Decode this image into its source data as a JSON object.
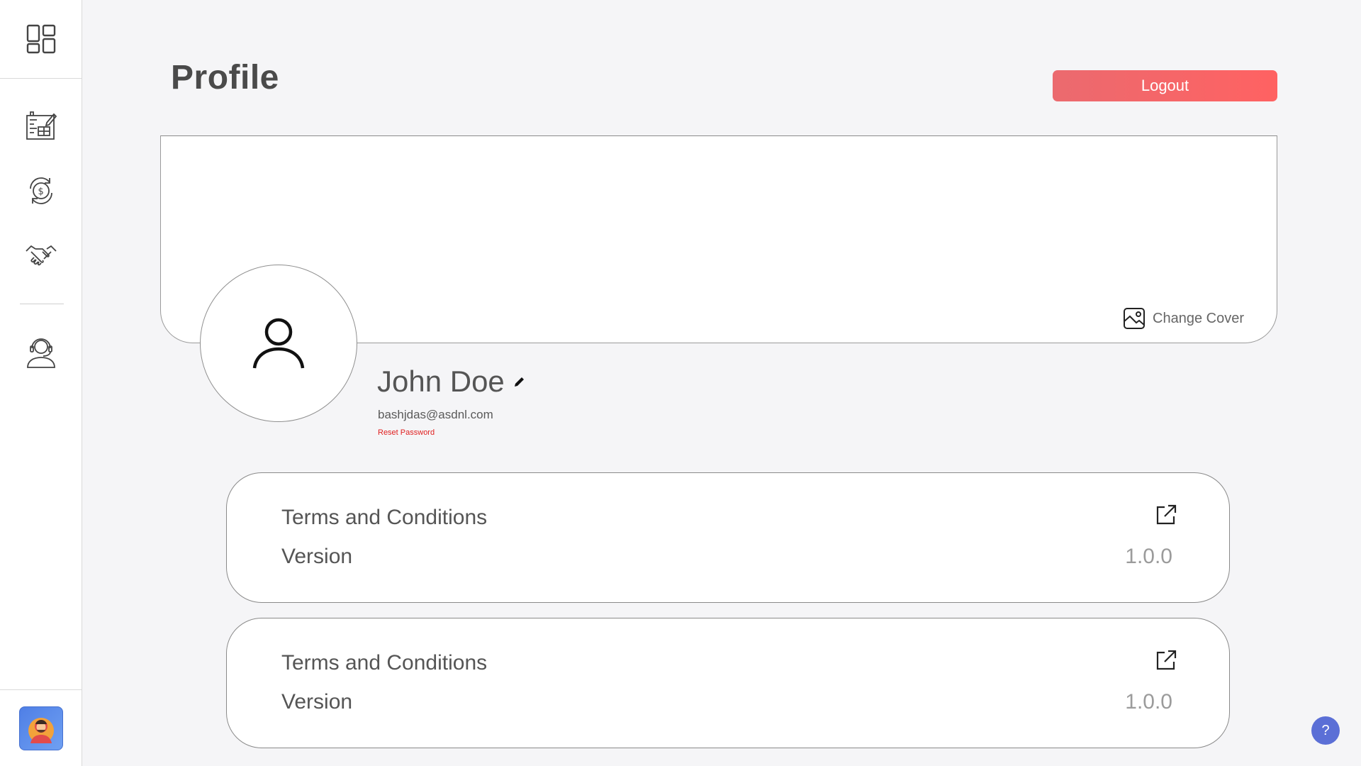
{
  "page": {
    "title": "Profile"
  },
  "header": {
    "logout_label": "Logout"
  },
  "sidebar": {
    "items": [
      {
        "name": "dashboard",
        "icon": "dashboard-grid-icon"
      },
      {
        "name": "plans",
        "icon": "blueprint-icon"
      },
      {
        "name": "finance",
        "icon": "dollar-cycle-icon"
      },
      {
        "name": "deals",
        "icon": "handshake-icon"
      },
      {
        "name": "support",
        "icon": "support-agent-icon"
      }
    ],
    "user_avatar_icon": "user-avatar-icon"
  },
  "cover": {
    "change_label": "Change Cover",
    "change_icon": "image-icon"
  },
  "profile": {
    "name": "John Doe",
    "email": "bashjdas@asdnl.com",
    "reset_password_label": "Reset Password"
  },
  "cards": [
    {
      "terms_label": "Terms and Conditions",
      "version_label": "Version",
      "version_value": "1.0.0"
    },
    {
      "terms_label": "Terms and Conditions",
      "version_label": "Version",
      "version_value": "1.0.0"
    }
  ],
  "help_label": "?",
  "colors": {
    "logout": "#ff6262",
    "reset_link": "#e02020",
    "help": "#5b6fd6"
  }
}
